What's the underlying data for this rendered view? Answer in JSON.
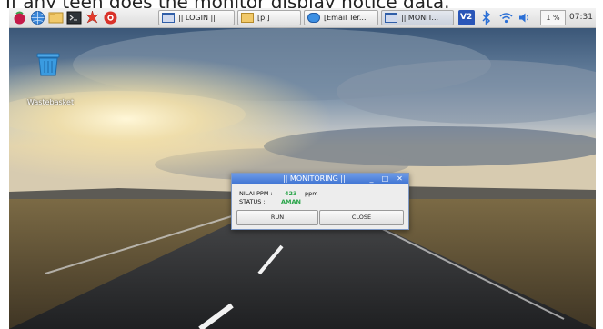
{
  "caption": {
    "text": "If any teen goes the monitor display notice data."
  },
  "taskbar": {
    "launchers": [
      {
        "icon": "raspberry-menu-icon"
      },
      {
        "icon": "globe-browser-icon"
      },
      {
        "icon": "file-manager-icon"
      },
      {
        "icon": "terminal-icon"
      },
      {
        "icon": "star-burst-icon"
      },
      {
        "icon": "red-circle-app-icon"
      }
    ],
    "windows": [
      {
        "label": "|| LOGIN ||",
        "icon": "window-icon"
      },
      {
        "label": "[pi]",
        "icon": "folder-icon"
      },
      {
        "label": "[Email Ter...",
        "icon": "email-app-icon"
      },
      {
        "label": "|| MONIT...",
        "icon": "window-icon"
      }
    ],
    "tray": {
      "vnc_label": "V2",
      "cpu_label": "1 %",
      "clock": "07:31"
    }
  },
  "desktop": {
    "icons": [
      {
        "label": "Wastebasket",
        "icon": "wastebasket-icon"
      }
    ]
  },
  "dialog": {
    "title": "|| MONITORING ||",
    "controls": [
      "_",
      "□",
      "✕"
    ],
    "ppm_label": "NILAI PPM :",
    "ppm_value": "423",
    "ppm_unit": "ppm",
    "status_label": "STATUS :",
    "status_value": "AMAN",
    "run_label": "RUN",
    "close_label": "CLOSE"
  },
  "colors": {
    "accent_title": "#3e73d3",
    "value_green": "#2aa54a",
    "taskbar": "#e6e6e6"
  }
}
